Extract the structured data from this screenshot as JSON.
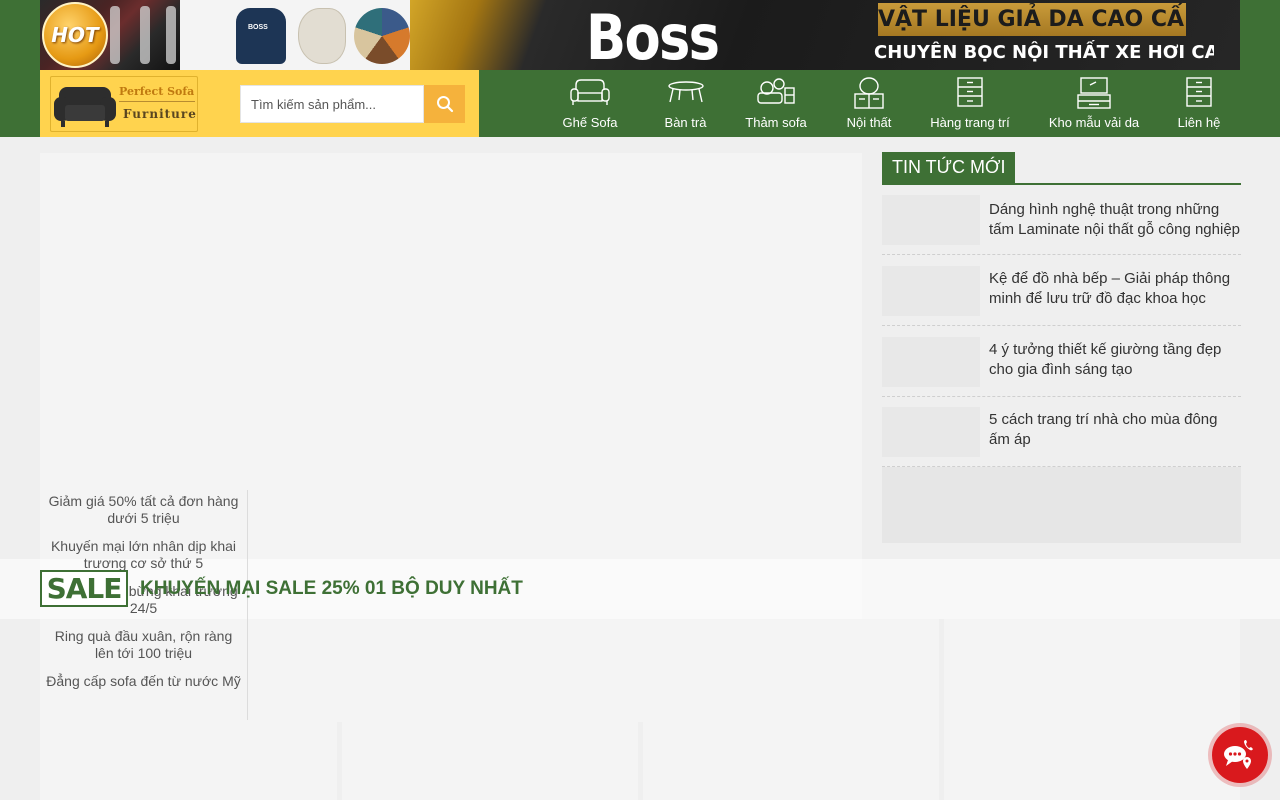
{
  "banner": {
    "hot_label": "HOT",
    "brand": "Boss",
    "sample_brand": "BOSS",
    "tagline1": "VẬT LIỆU GIẢ DA CAO CẤP",
    "tagline2": "CHUYÊN BỌC NỘI THẤT XE HƠI CAO CẤP"
  },
  "header": {
    "logo_line1": "Perfect Sofa",
    "logo_line2": "Furniture",
    "search_placeholder": "Tìm kiếm sản phẩm...",
    "search_icon": "search-icon"
  },
  "nav": {
    "items": [
      {
        "label": "Ghế Sofa",
        "icon": "sofa-icon"
      },
      {
        "label": "Bàn trà",
        "icon": "table-icon"
      },
      {
        "label": "Thảm sofa",
        "icon": "rug-icon"
      },
      {
        "label": "Nội thất",
        "icon": "vanity-icon"
      },
      {
        "label": "Hàng trang trí",
        "icon": "cabinet-icon"
      },
      {
        "label": "Kho mẫu vải da",
        "icon": "tv-stand-icon"
      },
      {
        "label": "Liên hệ",
        "icon": "drawer-icon"
      }
    ]
  },
  "promos": [
    "Giảm giá 50% tất cả đơn hàng dưới 5 triệu",
    "Khuyến mại lớn nhân dịp khai trương cơ sở thứ 5",
    "Hà Nội tưng bừng khai trương 24/5",
    "Ring quà đầu xuân, rộn ràng lên tới 100 triệu",
    "Đẳng cấp sofa đến từ nước Mỹ"
  ],
  "sale": {
    "badge": "SALE",
    "title": "KHUYẾN MẠI SALE 25% 01 BỘ DUY NHẤT"
  },
  "news": {
    "title": "TIN TỨC MỚI",
    "items": [
      "Dáng hình nghệ thuật trong những tấm Laminate nội thất gỗ công nghiệp",
      "Kệ để đồ nhà bếp – Giải pháp thông minh để lưu trữ đồ đạc khoa học",
      "4 ý tưởng thiết kế giường tầng đẹp cho gia đình sáng tạo",
      "5 cách trang trí nhà cho mùa đông ấm áp"
    ]
  },
  "colors": {
    "primary_green": "#3e7035",
    "accent_yellow": "#ffd34e",
    "search_orange": "#f5b23c",
    "contact_red": "#d9191d"
  }
}
